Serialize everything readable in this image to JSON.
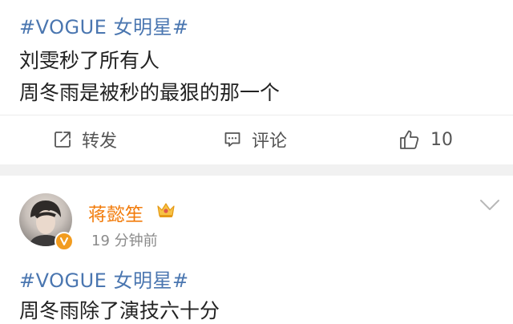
{
  "post1": {
    "hashtag": "#VOGUE 女明星#",
    "lines": [
      "刘雯秒了所有人",
      "周冬雨是被秒的最狠的那一个"
    ],
    "actions": {
      "repost_label": "转发",
      "comment_label": "评论",
      "like_count": "10"
    }
  },
  "post2": {
    "username": "蒋懿笙",
    "time": "19 分钟前",
    "hashtag": "#VOGUE 女明星#",
    "lines": [
      "周冬雨除了演技六十分"
    ]
  },
  "colors": {
    "hashtag": "#4a76b0",
    "username": "#f27c0c",
    "badge": "#f29c1f",
    "separator": "#f1f1f1"
  },
  "icons": [
    "share-icon",
    "comment-icon",
    "like-icon",
    "verified-icon",
    "crown-icon",
    "chevron-down-icon"
  ]
}
